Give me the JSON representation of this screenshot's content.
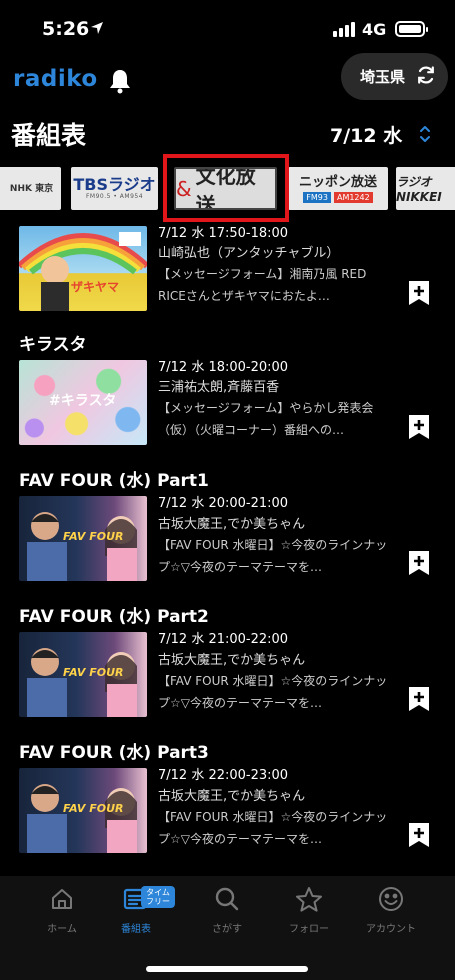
{
  "status_bar": {
    "time": "5:26",
    "network": "4G"
  },
  "header": {
    "logo": "radiko",
    "prefecture_button": "埼玉県",
    "title": "番組表",
    "date": "7/12 水"
  },
  "stations": {
    "nhk": "NHK 東京",
    "tbs_main": "TBSラジオ",
    "tbs_sub": "FM90.5 • AM954",
    "qr_amp": "&",
    "qr_name": "文化放送",
    "lf_main": "ニッポン放送",
    "lf_fm": "FM93",
    "lf_am": "AM1242",
    "ni": "ラジオNIKKEI"
  },
  "programs": [
    {
      "title": "",
      "time": "7/12 水 17:50-18:00",
      "cast": "山崎弘也（アンタッチャブル）",
      "desc": "【メッセージフォーム】湘南乃風 RED RICEさんとザキヤマにおたよ…",
      "thumb_text": "ザキヤマ"
    },
    {
      "title": "キラスタ",
      "time": "7/12 水 18:00-20:00",
      "cast": "三浦祐太朗,斉藤百香",
      "desc": "【メッセージフォーム】やらかし発表会（仮）（火曜コーナー）番組への…",
      "thumb_text": "#キラスタ"
    },
    {
      "title": "FAV FOUR (水) Part1",
      "time": "7/12 水 20:00-21:00",
      "cast": "古坂大魔王,でか美ちゃん",
      "desc": "【FAV FOUR 水曜日】☆今夜のラインナップ☆▽今夜のテーマテーマを…",
      "thumb_text": "FAV FOUR"
    },
    {
      "title": "FAV FOUR (水) Part2",
      "time": "7/12 水 21:00-22:00",
      "cast": "古坂大魔王,でか美ちゃん",
      "desc": "【FAV FOUR 水曜日】☆今夜のラインナップ☆▽今夜のテーマテーマを…",
      "thumb_text": "FAV FOUR"
    },
    {
      "title": "FAV FOUR (水) Part3",
      "time": "7/12 水 22:00-23:00",
      "cast": "古坂大魔王,でか美ちゃん",
      "desc": "【FAV FOUR 水曜日】☆今夜のラインナップ☆▽今夜のテーマテーマを…",
      "thumb_text": "FAV FOUR"
    }
  ],
  "tabbar": {
    "home": "ホーム",
    "program": "番組表",
    "badge": "タイム フリー",
    "search": "さがす",
    "follow": "フォロー",
    "account": "アカウント"
  },
  "colors": {
    "accent": "#2d86d9",
    "highlight": "#e0161b"
  }
}
